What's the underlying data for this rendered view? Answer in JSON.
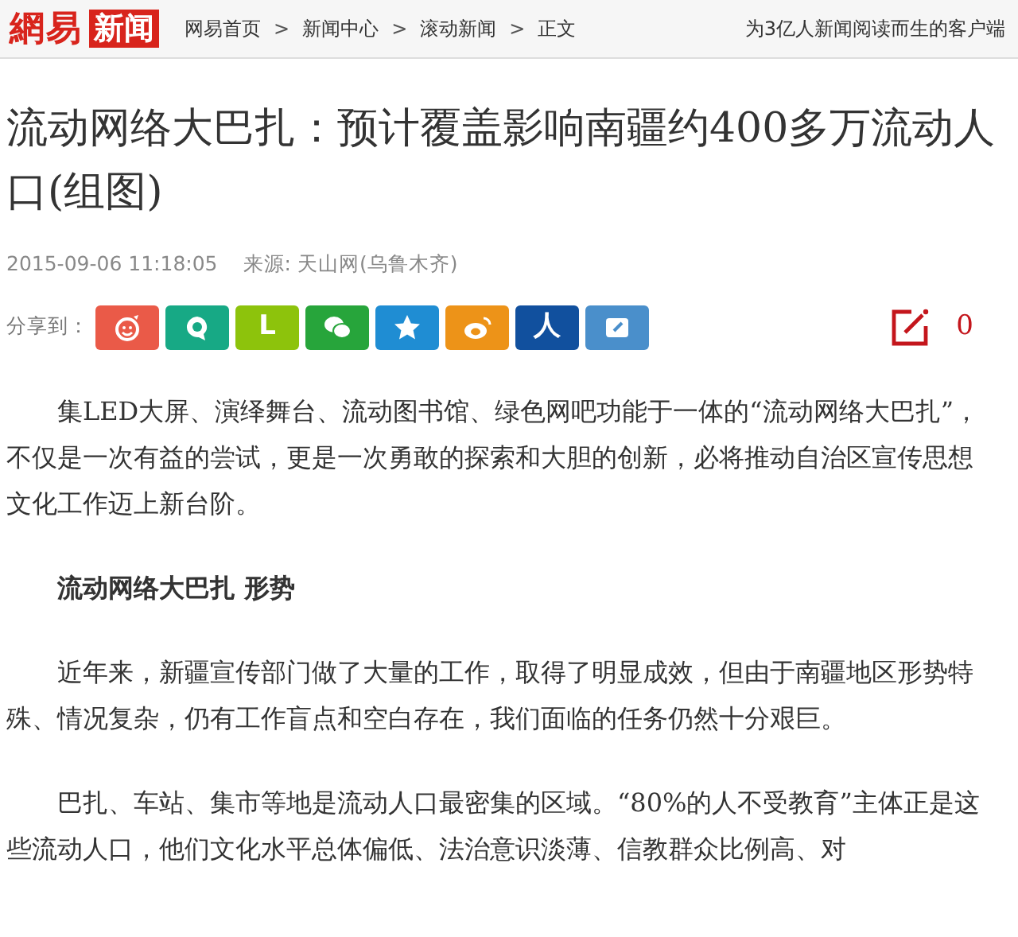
{
  "header": {
    "logo_left": "網易",
    "logo_right": "新闻",
    "breadcrumbs": [
      {
        "label": "网易首页"
      },
      {
        "label": "新闻中心"
      },
      {
        "label": "滚动新闻"
      },
      {
        "label": "正文"
      }
    ],
    "separator": ">",
    "slogan": "为3亿人新闻阅读而生的客户端"
  },
  "article": {
    "title": "流动网络大巴扎：预计覆盖影响南疆约400多万流动人口(组图)",
    "time": "2015-09-06 11:18:05",
    "source": "来源: 天山网(乌鲁木齐)",
    "share": {
      "label": "分享到：",
      "buttons": [
        {
          "kind": "smile",
          "color": "#ea5a48"
        },
        {
          "kind": "bubble",
          "color": "#17a985"
        },
        {
          "kind": "letter",
          "glyph": "L",
          "color": "#8dc30c"
        },
        {
          "kind": "chat",
          "color": "#27a53b"
        },
        {
          "kind": "star",
          "color": "#1f8dd3"
        },
        {
          "kind": "eye",
          "color": "#ed9318"
        },
        {
          "kind": "letter",
          "glyph": "人",
          "color": "#11509e"
        },
        {
          "kind": "note",
          "color": "#4a8fcb"
        }
      ]
    },
    "comment_count": "0",
    "blocks": [
      {
        "kind": "para",
        "text": "集LED大屏、演绎舞台、流动图书馆、绿色网吧功能于一体的“流动网络大巴扎”，不仅是一次有益的尝试，更是一次勇敢的探索和大胆的创新，必将推动自治区宣传思想文化工作迈上新台阶。"
      },
      {
        "kind": "heading",
        "text": "流动网络大巴扎  形势"
      },
      {
        "kind": "para",
        "text": "近年来，新疆宣传部门做了大量的工作，取得了明显成效，但由于南疆地区形势特殊、情况复杂，仍有工作盲点和空白存在，我们面临的任务仍然十分艰巨。"
      },
      {
        "kind": "para",
        "text": "巴扎、车站、集市等地是流动人口最密集的区域。“80%的人不受教育”主体正是这些流动人口，他们文化水平总体偏低、法治意识淡薄、信教群众比例高、对"
      }
    ]
  }
}
